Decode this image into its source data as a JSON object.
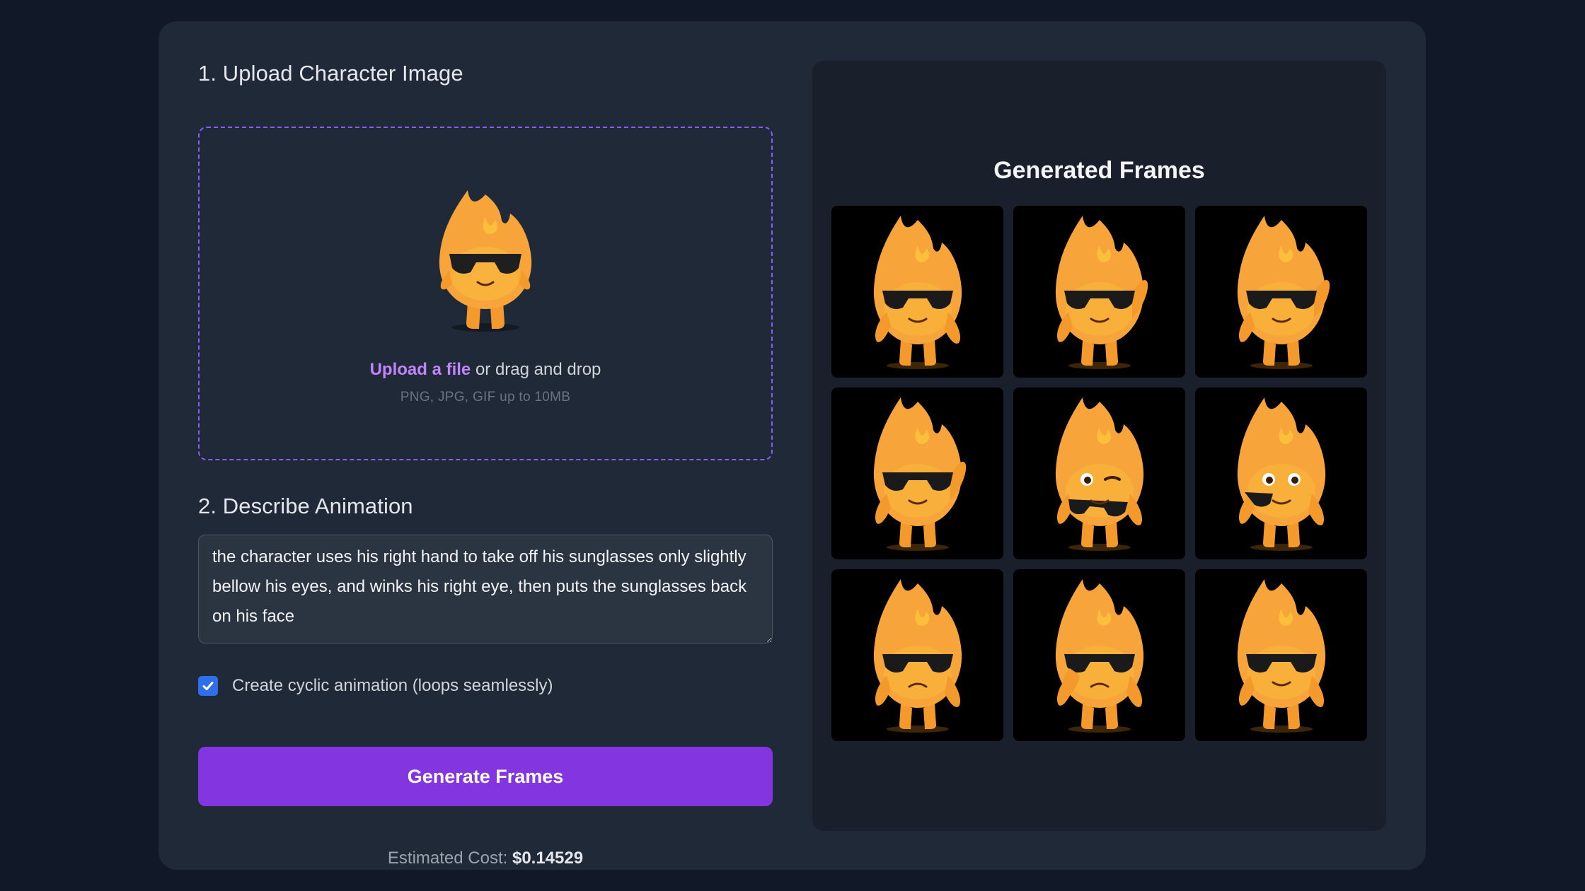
{
  "upload": {
    "title": "1. Upload Character Image",
    "link_text": "Upload a file",
    "drag_text": " or drag and drop",
    "hint": "PNG, JPG, GIF up to 10MB",
    "preview_icon": "flame-character-image"
  },
  "describe": {
    "title": "2. Describe Animation",
    "prompt_value": "the character uses his right hand to take off his sunglasses only slightly bellow his eyes, and winks his right eye, then puts the sunglasses back on his face"
  },
  "cyclic": {
    "label": "Create cyclic animation (loops seamlessly)",
    "checked": true
  },
  "generate_button": {
    "label": "Generate Frames"
  },
  "cost": {
    "label": "Estimated Cost: ",
    "value": "$0.14529"
  },
  "frames": {
    "title": "Generated Frames",
    "items": [
      {
        "pose": "glasses-on"
      },
      {
        "pose": "hand-on-glasses"
      },
      {
        "pose": "hand-on-glasses"
      },
      {
        "pose": "lowering-glasses"
      },
      {
        "pose": "winking"
      },
      {
        "pose": "glasses-in-hand"
      },
      {
        "pose": "glasses-on-frown"
      },
      {
        "pose": "glasses-on-frown-hand-up"
      },
      {
        "pose": "glasses-on"
      }
    ]
  },
  "colors": {
    "background": "#111827",
    "card": "#1f2937",
    "accent": "#8336e0",
    "link": "#c084fc",
    "checkbox": "#2f6fec",
    "flame": "#f59e0b"
  }
}
